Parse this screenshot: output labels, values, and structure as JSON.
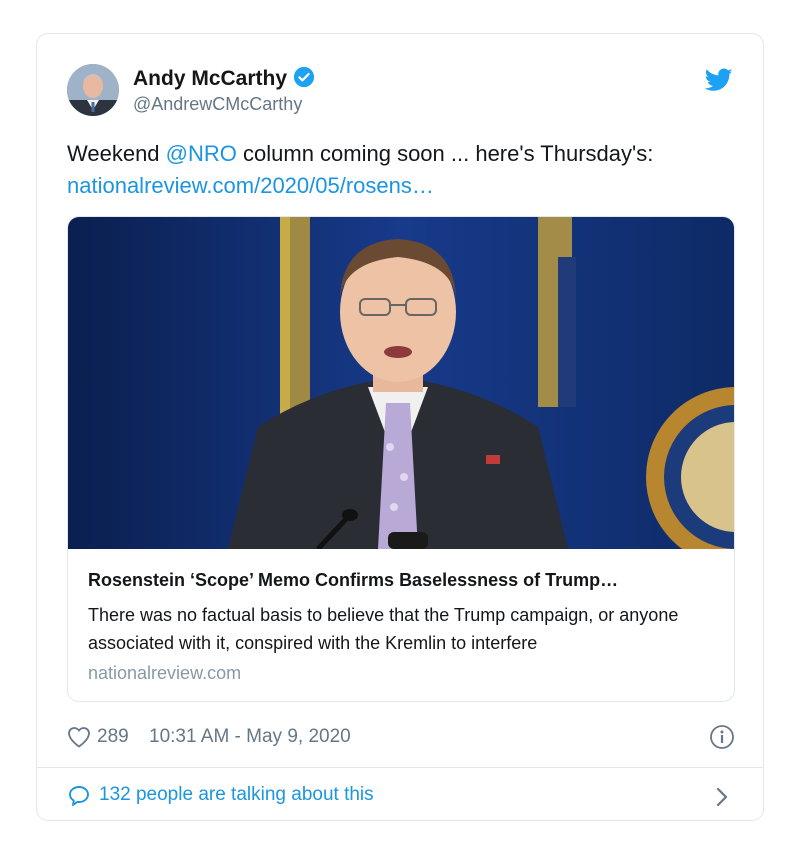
{
  "author": {
    "name": "Andy McCarthy",
    "handle": "@AndrewCMcCarthy",
    "verified": true
  },
  "tweet": {
    "text_prefix": "Weekend ",
    "mention": "@NRO",
    "text_suffix": " column coming soon ... here's Thursday's:",
    "link": "nationalreview.com/2020/05/rosens…"
  },
  "link_card": {
    "title": "Rosenstein ‘Scope’ Memo Confirms Baselessness of Trump…",
    "description": "There was no factual basis to believe that the Trump campaign, or anyone associated with it, conspired with the Kremlin to interfere",
    "domain": "nationalreview.com"
  },
  "footer": {
    "likes": "289",
    "timestamp": "10:31 AM - May 9, 2020",
    "talking": "132 people are talking about this"
  },
  "icons": {
    "bird": "twitter-bird-icon",
    "verified": "verified-badge-icon",
    "like": "heart-icon",
    "info": "info-icon",
    "reply": "speech-bubble-icon",
    "more": "chevron-right-icon"
  },
  "colors": {
    "accent": "#1b95e0",
    "secondary_text": "#657786",
    "border": "#e1e8ed"
  }
}
